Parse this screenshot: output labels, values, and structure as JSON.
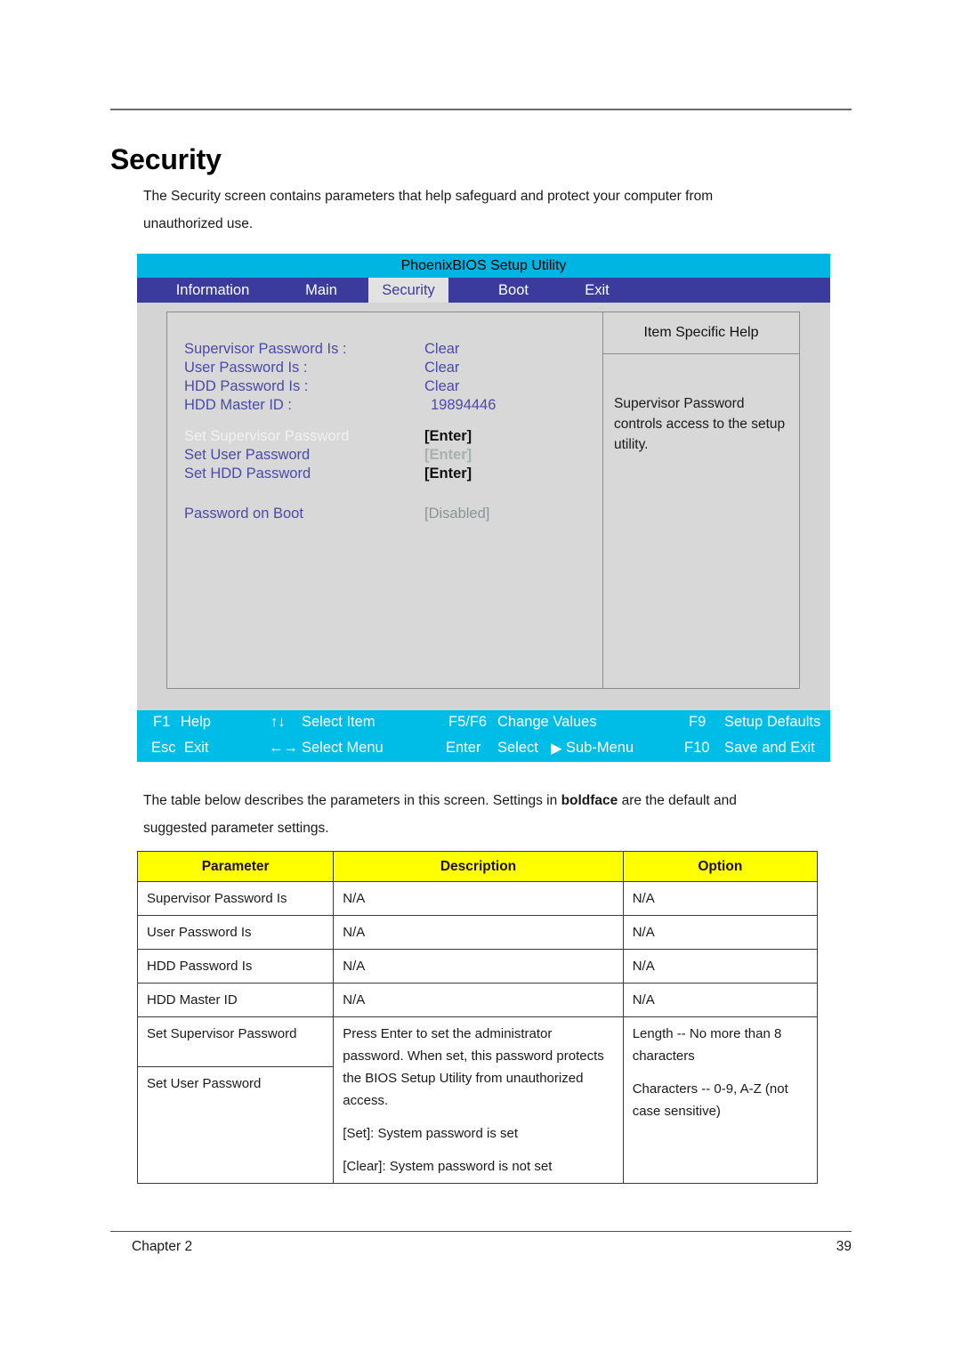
{
  "document": {
    "page_title": "Security",
    "intro": "The Security screen contains parameters that help safeguard and protect your computer from unauthorized use.",
    "afterword_part1": "The table below describes the parameters in this screen. Settings in ",
    "afterword_bold": "boldface",
    "afterword_part2": " are the default and suggested  parameter settings.",
    "footer_chapter": "Chapter 2",
    "footer_page": "39"
  },
  "bios": {
    "window_title": "PhoenixBIOS Setup Utility",
    "tabs": [
      {
        "label": "Information",
        "selected": false
      },
      {
        "label": "Main",
        "selected": false
      },
      {
        "label": "Security",
        "selected": true
      },
      {
        "label": "Boot",
        "selected": false
      },
      {
        "label": "Exit",
        "selected": false
      }
    ],
    "help": {
      "title": "Item Specific Help",
      "text": "Supervisor Password controls access to the setup utility."
    },
    "settings": [
      {
        "label": "Supervisor Password Is :",
        "value": "Clear"
      },
      {
        "label": "User Password Is :",
        "value": "Clear"
      },
      {
        "label": "HDD Password Is :",
        "value": "Clear"
      },
      {
        "label": "HDD Master ID :",
        "value": "19894446"
      },
      {
        "label": "Set Supervisor Password",
        "value": "[Enter]"
      },
      {
        "label": "Set User Password",
        "value": "[Enter]"
      },
      {
        "label": "Set HDD Password",
        "value": "[Enter]"
      },
      {
        "label": "Password on Boot",
        "value": "[Disabled]"
      }
    ],
    "keybar": {
      "row1": [
        {
          "key": "F1",
          "action": "Help"
        },
        {
          "key": "↑↓",
          "action": "Select Item"
        },
        {
          "key": "F5/F6",
          "action": "Change Values"
        },
        {
          "key": "F9",
          "action": "Setup Defaults"
        }
      ],
      "row2": [
        {
          "key": "Esc",
          "action": "Exit"
        },
        {
          "key": "←→",
          "action": "Select Menu"
        },
        {
          "key": "Enter",
          "action": "Select",
          "extra": "Sub-Menu",
          "arrow": "▶"
        },
        {
          "key": "F10",
          "action": "Save and Exit"
        }
      ]
    },
    "colors": {
      "titlebar": "#00b5e2",
      "tabbar": "#3b3b9e",
      "selected_tab_bg": "#e2e2e2",
      "panel": "#d4d4d4",
      "label": "#4a4aa8",
      "keybar": "#00bde8"
    }
  },
  "table": {
    "headers": [
      "Parameter",
      "Description",
      "Option"
    ],
    "rows": [
      {
        "parameter": "Supervisor Password Is",
        "description": [
          "N/A"
        ],
        "option": [
          "N/A"
        ]
      },
      {
        "parameter": "User Password Is",
        "description": [
          "N/A"
        ],
        "option": [
          "N/A"
        ]
      },
      {
        "parameter": "HDD Password Is",
        "description": [
          "N/A"
        ],
        "option": [
          "N/A"
        ]
      },
      {
        "parameter": "HDD Master ID",
        "description": [
          "N/A"
        ],
        "option": [
          "N/A"
        ]
      }
    ],
    "merged_row": {
      "parameter_1": "Set Supervisor Password",
      "parameter_2": "Set User Password",
      "description": [
        "Press Enter to set the administrator password. When set, this password protects the BIOS Setup Utility from unauthorized access.",
        "[Set]: System password is set",
        "[Clear]: System password is not set"
      ],
      "option": [
        "Length -- No more than 8 characters",
        "Characters -- 0-9, A-Z (not case sensitive)"
      ]
    }
  }
}
